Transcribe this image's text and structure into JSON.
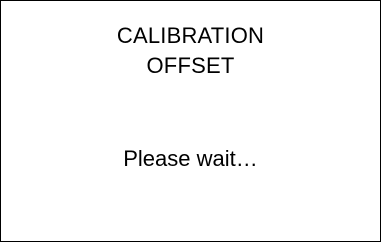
{
  "screen": {
    "title_line_1": "CALIBRATION",
    "title_line_2": "OFFSET",
    "message": "Please wait…"
  }
}
